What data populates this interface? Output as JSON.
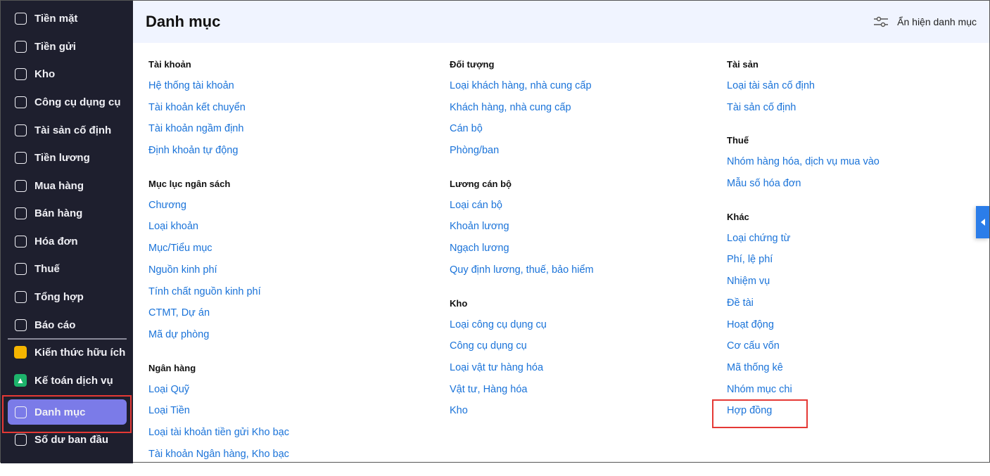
{
  "sidebar": {
    "items": [
      {
        "label": "Tiền mặt",
        "icon": "cash-icon"
      },
      {
        "label": "Tiền gửi",
        "icon": "deposit-icon"
      },
      {
        "label": "Kho",
        "icon": "warehouse-icon"
      },
      {
        "label": "Công cụ dụng cụ",
        "icon": "tools-icon"
      },
      {
        "label": "Tài sản cố định",
        "icon": "truck-icon"
      },
      {
        "label": "Tiền lương",
        "icon": "salary-icon"
      },
      {
        "label": "Mua hàng",
        "icon": "cart-icon"
      },
      {
        "label": "Bán hàng",
        "icon": "store-icon"
      },
      {
        "label": "Hóa đơn",
        "icon": "invoice-icon"
      },
      {
        "label": "Thuế",
        "icon": "bank-icon"
      },
      {
        "label": "Tổng hợp",
        "icon": "summary-icon"
      },
      {
        "label": "Báo cáo",
        "icon": "report-icon"
      },
      {
        "label": "Kiến thức hữu ích",
        "icon": "knowledge-icon"
      },
      {
        "label": "Kế toán dịch vụ",
        "icon": "service-icon"
      },
      {
        "label": "Danh mục",
        "icon": "catalog-icon"
      },
      {
        "label": "Số dư ban đầu",
        "icon": "balance-icon"
      }
    ]
  },
  "header": {
    "title": "Danh mục",
    "toggle_label": "Ẩn hiện danh mục"
  },
  "columns": [
    [
      {
        "heading": "Tài khoản",
        "items": [
          "Hệ thống tài khoản",
          "Tài khoản kết chuyển",
          "Tài khoản ngầm định",
          "Định khoản tự động"
        ]
      },
      {
        "heading": "Mục lục ngân sách",
        "items": [
          "Chương",
          "Loại khoản",
          "Mục/Tiểu mục",
          "Nguồn kinh phí",
          "Tính chất nguồn kinh phí",
          "CTMT, Dự án",
          "Mã dự phòng"
        ]
      },
      {
        "heading": "Ngân hàng",
        "items": [
          "Loại Quỹ",
          "Loại Tiền",
          "Loại tài khoản tiền gửi Kho bạc",
          "Tài khoản Ngân hàng, Kho bạc"
        ]
      }
    ],
    [
      {
        "heading": "Đối tượng",
        "items": [
          "Loại khách hàng, nhà cung cấp",
          "Khách hàng, nhà cung cấp",
          "Cán bộ",
          "Phòng/ban"
        ]
      },
      {
        "heading": "Lương cán bộ",
        "items": [
          "Loại cán bộ",
          "Khoản lương",
          "Ngạch lương",
          "Quy định lương, thuế, bảo hiểm"
        ]
      },
      {
        "heading": "Kho",
        "items": [
          "Loại công cụ dụng cụ",
          "Công cụ dụng cụ",
          "Loại vật tư hàng hóa",
          "Vật tư, Hàng hóa",
          "Kho"
        ]
      }
    ],
    [
      {
        "heading": "Tài sản",
        "items": [
          "Loại tài sản cố định",
          "Tài sản cố định"
        ]
      },
      {
        "heading": "Thuế",
        "items": [
          "Nhóm hàng hóa, dịch vụ mua vào",
          "Mẫu số hóa đơn"
        ]
      },
      {
        "heading": "Khác",
        "items": [
          "Loại chứng từ",
          "Phí, lệ phí",
          "Nhiệm vụ",
          "Đề tài",
          "Hoạt động",
          "Cơ cấu vốn",
          "Mã thống kê",
          "Nhóm mục chi",
          "Hợp đồng"
        ]
      }
    ]
  ],
  "colors": {
    "sidebar": "#1e1f2e",
    "active": "#7b7be8",
    "link": "#1a73d9",
    "highlight": "#e53935"
  }
}
